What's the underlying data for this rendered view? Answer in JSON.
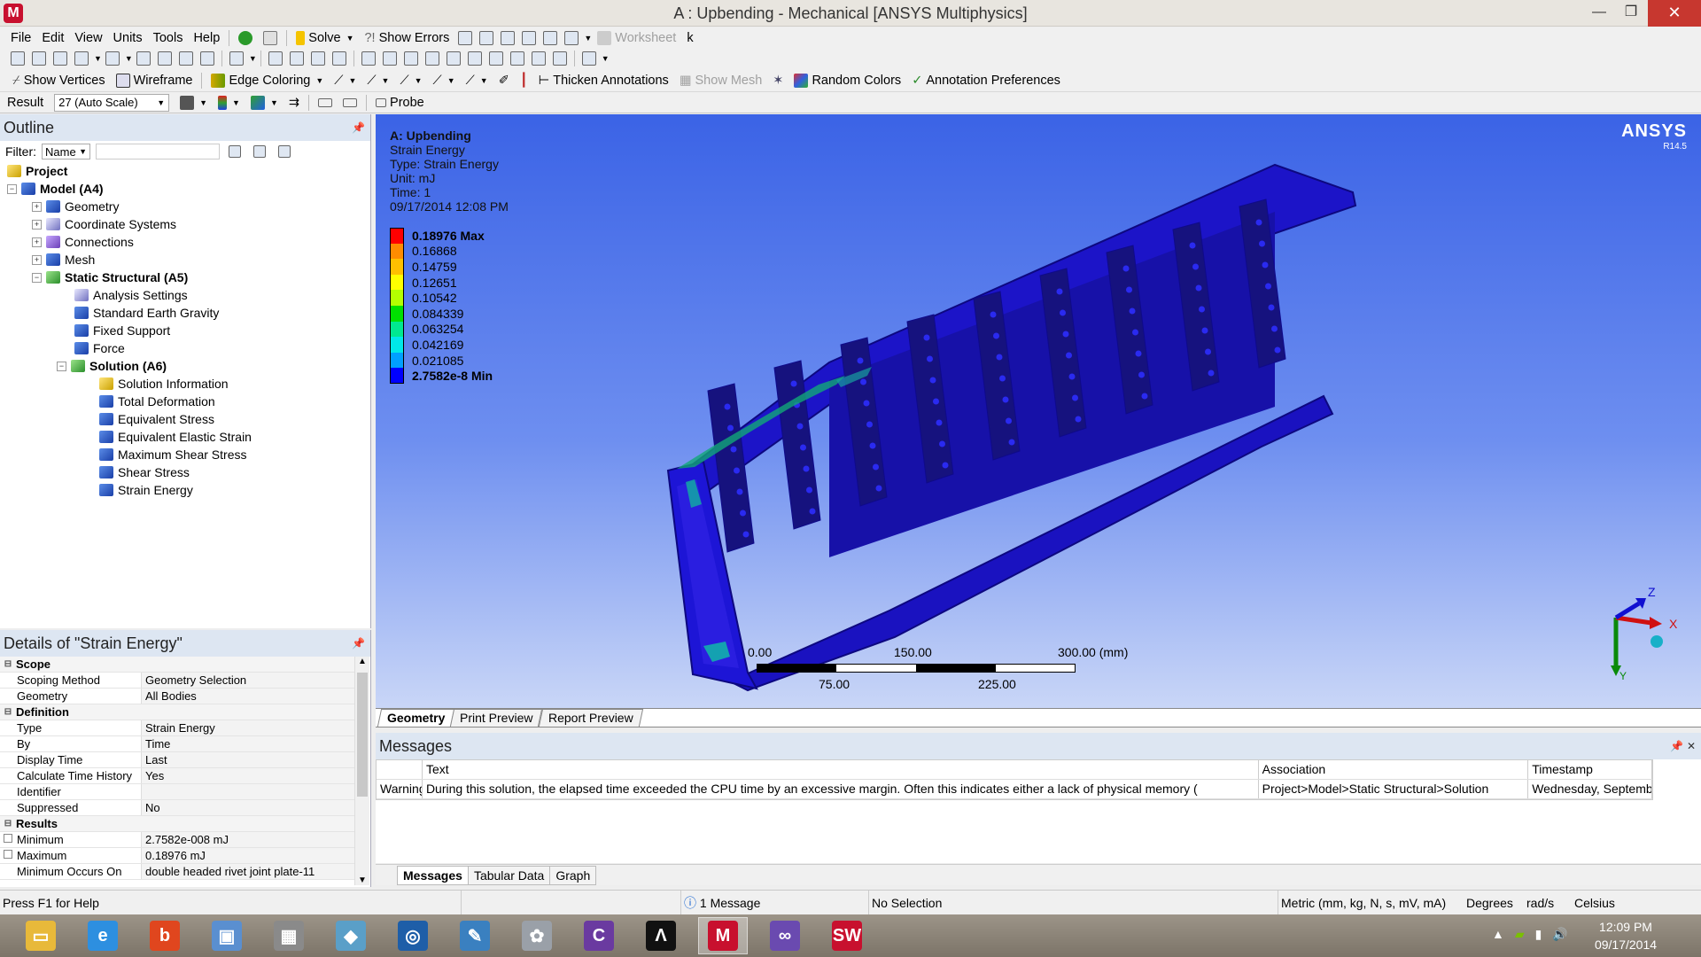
{
  "window": {
    "title": "A : Upbending - Mechanical [ANSYS Multiphysics]",
    "minimize": "—",
    "restore": "❐",
    "close": "✕"
  },
  "menu": [
    "File",
    "Edit",
    "View",
    "Units",
    "Tools",
    "Help"
  ],
  "toolbar1": {
    "solve": "Solve",
    "show_errors": "Show Errors",
    "worksheet": "Worksheet"
  },
  "toolbar3": {
    "show_vertices": "Show Vertices",
    "wireframe": "Wireframe",
    "edge_coloring": "Edge Coloring",
    "thicken_annotations": "Thicken Annotations",
    "show_mesh": "Show Mesh",
    "random_colors": "Random Colors",
    "annotation_preferences": "Annotation Preferences"
  },
  "toolbar4": {
    "result_label": "Result",
    "result_scale": "27 (Auto Scale)",
    "probe": "Probe"
  },
  "outline": {
    "title": "Outline",
    "filter_label": "Filter:",
    "filter_value": "Name",
    "tree": [
      {
        "label": "Project",
        "bold": true
      },
      {
        "label": "Model (A4)",
        "bold": true
      },
      {
        "label": "Geometry",
        "bold": false
      },
      {
        "label": "Coordinate Systems",
        "bold": false
      },
      {
        "label": "Connections",
        "bold": false
      },
      {
        "label": "Mesh",
        "bold": false
      },
      {
        "label": "Static Structural (A5)",
        "bold": true
      },
      {
        "label": "Analysis Settings",
        "bold": false
      },
      {
        "label": "Standard Earth Gravity",
        "bold": false
      },
      {
        "label": "Fixed Support",
        "bold": false
      },
      {
        "label": "Force",
        "bold": false
      },
      {
        "label": "Solution (A6)",
        "bold": true
      },
      {
        "label": "Solution Information",
        "bold": false
      },
      {
        "label": "Total Deformation",
        "bold": false
      },
      {
        "label": "Equivalent Stress",
        "bold": false
      },
      {
        "label": "Equivalent Elastic Strain",
        "bold": false
      },
      {
        "label": "Maximum Shear Stress",
        "bold": false
      },
      {
        "label": "Shear Stress",
        "bold": false
      },
      {
        "label": "Strain Energy",
        "bold": false
      }
    ]
  },
  "details": {
    "title": "Details of \"Strain Energy\"",
    "rows": [
      {
        "section": "Scope"
      },
      {
        "label": "Scoping Method",
        "value": "Geometry Selection"
      },
      {
        "label": "Geometry",
        "value": "All Bodies"
      },
      {
        "section": "Definition"
      },
      {
        "label": "Type",
        "value": "Strain Energy"
      },
      {
        "label": "By",
        "value": "Time"
      },
      {
        "label": "Display Time",
        "value": "Last"
      },
      {
        "label": "Calculate Time History",
        "value": "Yes"
      },
      {
        "label": "Identifier",
        "value": ""
      },
      {
        "label": "Suppressed",
        "value": "No"
      },
      {
        "section": "Results"
      },
      {
        "label": "Minimum",
        "value": "2.7582e-008 mJ"
      },
      {
        "label": "Maximum",
        "value": "0.18976 mJ"
      },
      {
        "label": "Minimum Occurs On",
        "value": "double headed rivet joint plate-11"
      }
    ]
  },
  "viewport": {
    "info": {
      "title": "A: Upbending",
      "result": "Strain Energy",
      "type": "Type: Strain Energy",
      "unit": "Unit: mJ",
      "time": "Time: 1",
      "date": "09/17/2014 12:08 PM"
    },
    "legend": [
      {
        "value": "0.18976 Max",
        "color": "#ff0000"
      },
      {
        "value": "0.16868",
        "color": "#ff8c00"
      },
      {
        "value": "0.14759",
        "color": "#ffc000"
      },
      {
        "value": "0.12651",
        "color": "#ffff00"
      },
      {
        "value": "0.10542",
        "color": "#b4ff00"
      },
      {
        "value": "0.084339",
        "color": "#00e000"
      },
      {
        "value": "0.063254",
        "color": "#00e890"
      },
      {
        "value": "0.042169",
        "color": "#00e8e8"
      },
      {
        "value": "0.021085",
        "color": "#00a0ff"
      },
      {
        "value": "2.7582e-8 Min",
        "color": "#0000ff"
      }
    ],
    "logo_name": "ANSYS",
    "logo_version": "R14.5",
    "scale": {
      "t0": "0.00",
      "t150": "150.00",
      "t300": "300.00 (mm)",
      "t75": "75.00",
      "t225": "225.00"
    },
    "triad": {
      "x": "X",
      "y": "Y",
      "z": "Z"
    }
  },
  "viewport_tabs": [
    "Geometry",
    "Print Preview",
    "Report Preview"
  ],
  "messages": {
    "title": "Messages",
    "headers": [
      "",
      "Text",
      "Association",
      "Timestamp"
    ],
    "rows": [
      [
        "Warning",
        "During this solution, the elapsed time exceeded the CPU time by an excessive margin.  Often this indicates either a lack of physical memory (",
        "Project>Model>Static Structural>Solution",
        "Wednesday, September"
      ]
    ],
    "tabs": [
      "Messages",
      "Tabular Data",
      "Graph"
    ]
  },
  "status": {
    "help": "Press F1 for Help",
    "messages": "1 Message",
    "selection": "No Selection",
    "units": "Metric (mm, kg, N, s, mV, mA)",
    "angle": "Degrees",
    "rate": "rad/s",
    "temp": "Celsius"
  },
  "taskbar": {
    "apps": [
      {
        "name": "file-explorer",
        "color": "#e8b93a",
        "glyph": "▭"
      },
      {
        "name": "internet-explorer",
        "color": "#2d8fe0",
        "glyph": "e"
      },
      {
        "name": "b-app",
        "color": "#e0461e",
        "glyph": "b"
      },
      {
        "name": "computer",
        "color": "#5a8fd0",
        "glyph": "▣"
      },
      {
        "name": "building-app",
        "color": "#8a8a8a",
        "glyph": "▦"
      },
      {
        "name": "network-app",
        "color": "#5a9fc8",
        "glyph": "◆"
      },
      {
        "name": "media-app",
        "color": "#1e5ea8",
        "glyph": "◎"
      },
      {
        "name": "brush-app",
        "color": "#3a80c0",
        "glyph": "✎"
      },
      {
        "name": "network-tools",
        "color": "#9aa0a8",
        "glyph": "✿"
      },
      {
        "name": "c-app",
        "color": "#6a3aa0",
        "glyph": "C"
      },
      {
        "name": "ansys-workbench",
        "color": "#111111",
        "glyph": "Λ"
      },
      {
        "name": "mechanical-app",
        "color": "#c8102e",
        "glyph": "M"
      },
      {
        "name": "visual-studio",
        "color": "#6a4ab0",
        "glyph": "∞"
      },
      {
        "name": "solidworks",
        "color": "#c8102e",
        "glyph": "SW"
      }
    ],
    "time": "12:09 PM",
    "date": "09/17/2014"
  },
  "colors": {
    "model_fill": "#1b13d0",
    "model_dark": "#0f0a8a",
    "plate_dark": "#16127e"
  }
}
